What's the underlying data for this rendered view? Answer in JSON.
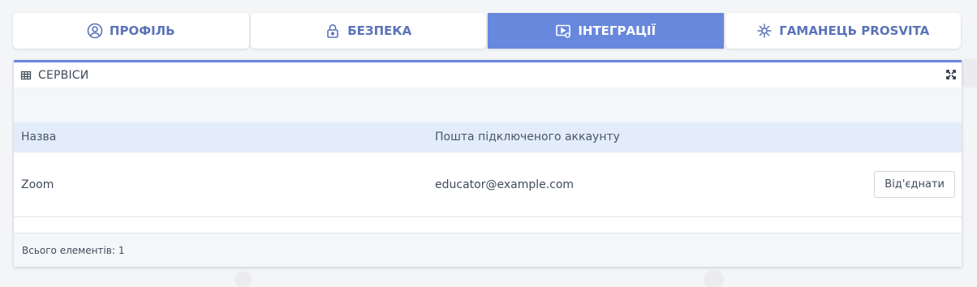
{
  "tabs": [
    {
      "label": "ПРОФІЛЬ",
      "icon": "user-circle-icon",
      "active": false
    },
    {
      "label": "БЕЗПЕКА",
      "icon": "lock-icon",
      "active": false
    },
    {
      "label": "ІНТЕГРАЦІЇ",
      "icon": "integrations-icon",
      "active": true
    },
    {
      "label": "ГАМАНЕЦЬ PROSVITA",
      "icon": "snowflake-icon",
      "active": false
    }
  ],
  "panel": {
    "title": "СЕРВІСИ",
    "icon": "table-grid-icon",
    "expand_icon": "expand-icon",
    "columns": {
      "name": "Назва",
      "email": "Пошта підключеного аккаунту"
    },
    "rows": [
      {
        "name": "Zoom",
        "email": "educator@example.com",
        "action": "Від'єднати"
      }
    ],
    "footer": {
      "label": "Всього елементів:",
      "count": "1"
    }
  },
  "colors": {
    "accent": "#6888dd",
    "tab_text": "#5b73b8",
    "header_row_bg": "#e3edf9",
    "strip_bg": "#f4f7fa"
  }
}
